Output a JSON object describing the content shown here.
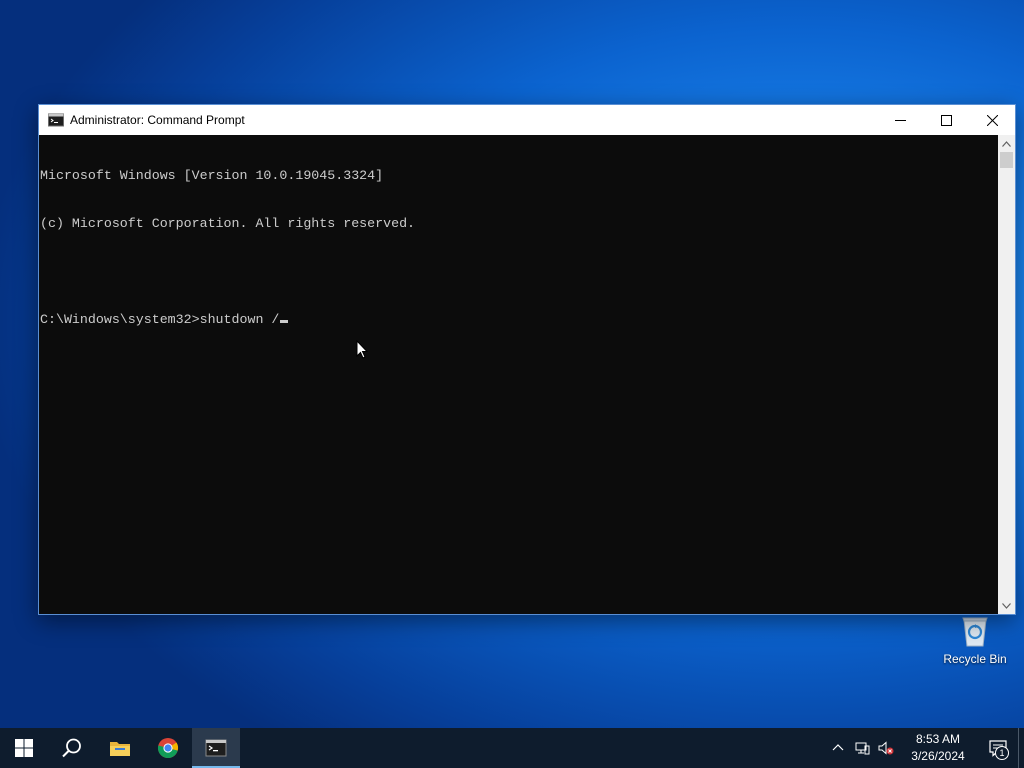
{
  "desktop": {
    "icons": [
      {
        "label": "Recycle Bin",
        "icon": "recycle-bin-icon"
      }
    ]
  },
  "window": {
    "title": "Administrator: Command Prompt",
    "icon": "cmd-icon",
    "controls": {
      "minimize": "minimize-icon",
      "maximize": "maximize-icon",
      "close": "close-icon"
    }
  },
  "console": {
    "lines": [
      "Microsoft Windows [Version 10.0.19045.3324]",
      "(c) Microsoft Corporation. All rights reserved.",
      "",
      "C:\\Windows\\system32>shutdown /"
    ],
    "foreground": "#cccccc",
    "background": "#0c0c0c"
  },
  "taskbar": {
    "buttons": [
      {
        "name": "start",
        "icon": "windows-logo-icon"
      },
      {
        "name": "search",
        "icon": "search-icon"
      },
      {
        "name": "file-explorer",
        "icon": "folder-icon"
      },
      {
        "name": "chrome",
        "icon": "chrome-icon"
      },
      {
        "name": "command-prompt",
        "icon": "cmd-icon",
        "active": true
      }
    ],
    "tray": {
      "icons": [
        "chevron-up-icon",
        "network-icon",
        "volume-muted-icon"
      ],
      "time": "8:53 AM",
      "date": "3/26/2024",
      "notification_count": "1"
    },
    "background": "#0e1c2d"
  }
}
